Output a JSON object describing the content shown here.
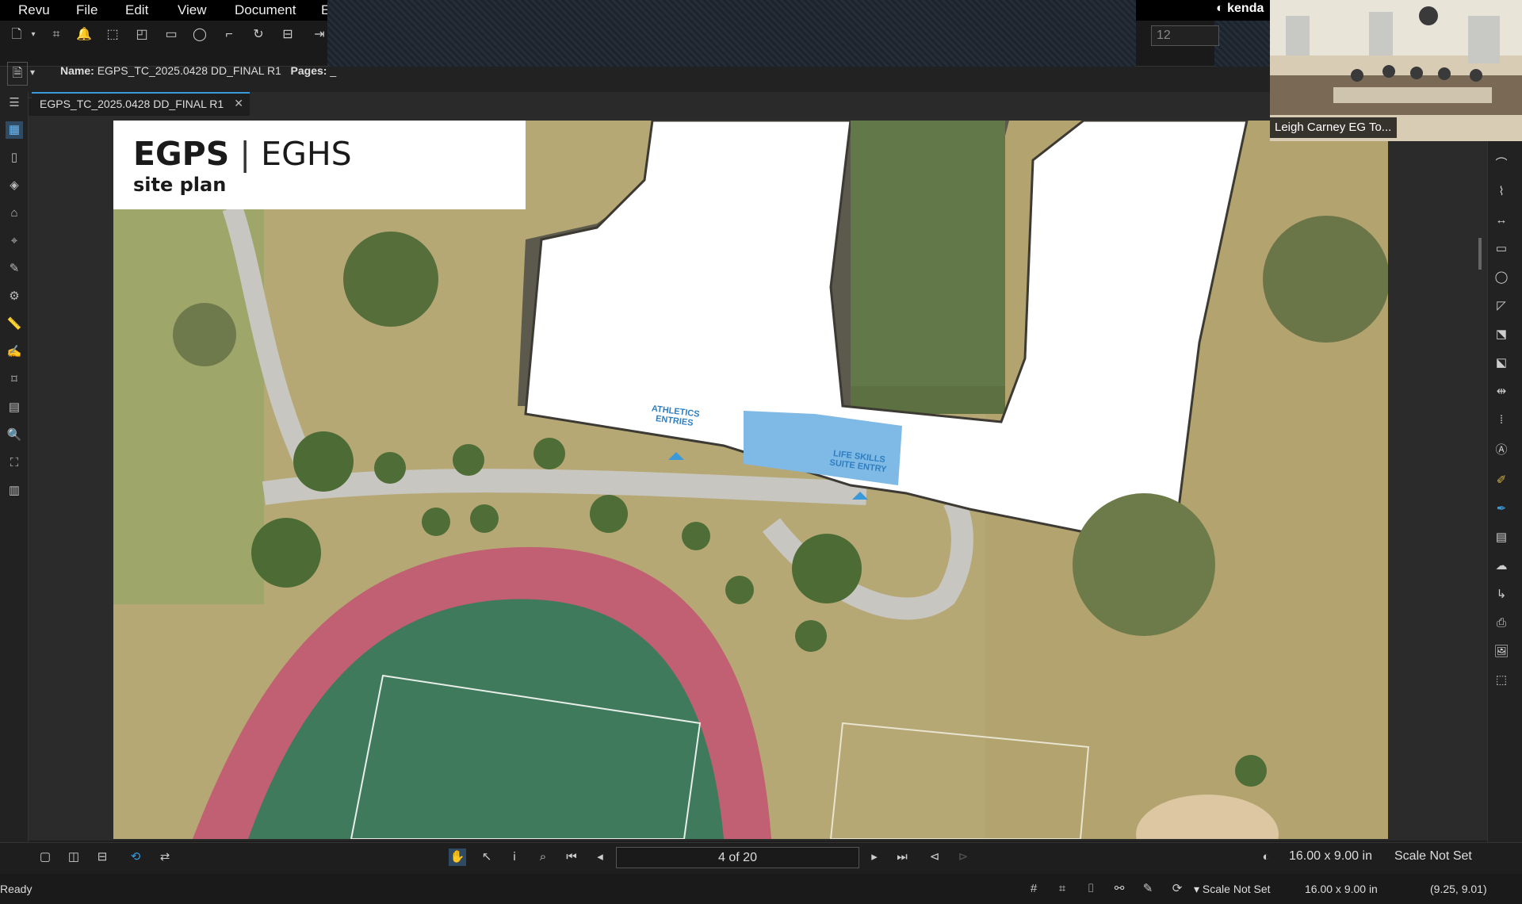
{
  "menu": {
    "items": [
      "Revu",
      "File",
      "Edit",
      "View",
      "Document",
      "E"
    ]
  },
  "brand": "kenda",
  "font_size": "12",
  "properties": {
    "name_label": "Name:",
    "name_value": "EGPS_TC_2025.0428 DD_FINAL R1",
    "pages_label": "Pages:",
    "pages_value": "_"
  },
  "tab": {
    "label": "EGPS_TC_2025.0428 DD_FINAL R1"
  },
  "plan": {
    "title_bold": "EGPS",
    "title_sep": "|",
    "title_rest": "EGHS",
    "subtitle": "site plan",
    "label_athletics": "ATHLETICS\nENTRIES",
    "label_lifeskills": "LIFE SKILLS\nSUITE ENTRY"
  },
  "navigation": {
    "page_indicator": "4 of 20"
  },
  "bottom_right": {
    "dimensions": "16.00 x 9.00 in",
    "scale": "Scale Not Set"
  },
  "status": {
    "ready": "Ready",
    "scale": "Scale Not Set",
    "dimensions": "16.00 x 9.00 in",
    "coordinates": "(9.25, 9.01)"
  },
  "video": {
    "participant": "Leigh Carney EG To..."
  },
  "colors": {
    "accent": "#3a9ad9",
    "track": "#c15f73",
    "field": "#3f7a5c",
    "building": "#ffffff",
    "entry": "#7fb9e6"
  }
}
